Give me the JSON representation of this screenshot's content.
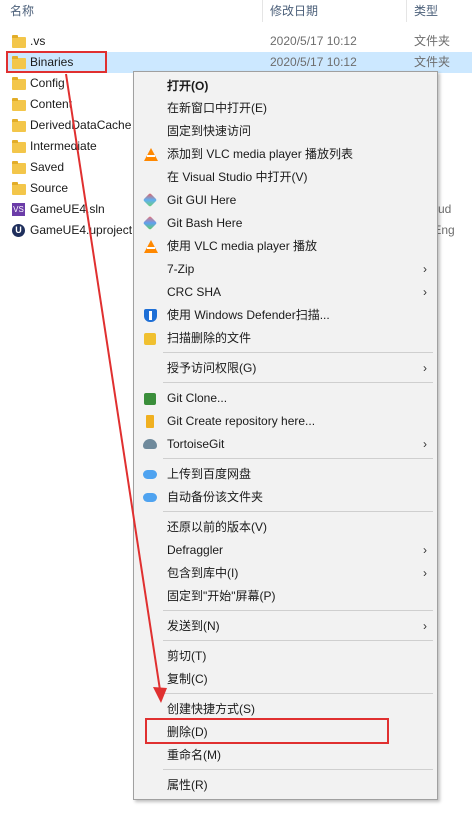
{
  "explorer": {
    "columns": {
      "name": "名称",
      "date": "修改日期",
      "type": "类型"
    },
    "files": [
      {
        "name": ".vs",
        "date": "2020/5/17 10:12",
        "type": "文件夹",
        "icon": "folder-icon"
      },
      {
        "name": "Binaries",
        "date": "2020/5/17 10:12",
        "type": "文件夹",
        "icon": "folder-icon",
        "selected": true
      },
      {
        "name": "Config",
        "date": "",
        "type": "",
        "icon": "folder-icon"
      },
      {
        "name": "Content",
        "date": "",
        "type": "",
        "icon": "folder-icon"
      },
      {
        "name": "DerivedDataCache",
        "date": "",
        "type": "",
        "icon": "folder-icon"
      },
      {
        "name": "Intermediate",
        "date": "",
        "type": "",
        "icon": "folder-icon"
      },
      {
        "name": "Saved",
        "date": "",
        "type": "",
        "icon": "folder-icon"
      },
      {
        "name": "Source",
        "date": "",
        "type": "",
        "icon": "folder-icon"
      },
      {
        "name": "GameUE4.sln",
        "date": "",
        "type": "al Stud",
        "icon": "visual-studio-icon"
      },
      {
        "name": "GameUE4.uproject",
        "date": "",
        "type": "eal Eng",
        "icon": "unreal-icon"
      }
    ]
  },
  "menu": {
    "items": [
      {
        "label": "打开(O)",
        "bold": true
      },
      {
        "label": "在新窗口中打开(E)"
      },
      {
        "label": "固定到快速访问"
      },
      {
        "label": "添加到 VLC media player 播放列表",
        "icon": "vlc-icon"
      },
      {
        "label": "在 Visual Studio 中打开(V)"
      },
      {
        "label": "Git GUI Here",
        "icon": "git-gui-icon"
      },
      {
        "label": "Git Bash Here",
        "icon": "git-bash-icon"
      },
      {
        "label": "使用 VLC media player 播放",
        "icon": "vlc-icon"
      },
      {
        "label": "7-Zip",
        "submenu": true
      },
      {
        "label": "CRC SHA",
        "submenu": true
      },
      {
        "label": "使用 Windows Defender扫描...",
        "icon": "windows-defender-icon"
      },
      {
        "label": "扫描删除的文件",
        "icon": "scan-icon"
      },
      {
        "label": "授予访问权限(G)",
        "submenu": true
      },
      {
        "label": "Git Clone...",
        "icon": "git-clone-icon"
      },
      {
        "label": "Git Create repository here...",
        "icon": "git-create-icon"
      },
      {
        "label": "TortoiseGit",
        "icon": "tortoisegit-icon",
        "submenu": true
      },
      {
        "label": "上传到百度网盘",
        "icon": "baidu-cloud-icon"
      },
      {
        "label": "自动备份该文件夹",
        "icon": "baidu-cloud-icon"
      },
      {
        "label": "还原以前的版本(V)"
      },
      {
        "label": "Defraggler",
        "submenu": true
      },
      {
        "label": "包含到库中(I)",
        "submenu": true
      },
      {
        "label": "固定到\"开始\"屏幕(P)"
      },
      {
        "label": "发送到(N)",
        "submenu": true
      },
      {
        "label": "剪切(T)"
      },
      {
        "label": "复制(C)"
      },
      {
        "label": "创建快捷方式(S)"
      },
      {
        "label": "删除(D)"
      },
      {
        "label": "重命名(M)"
      },
      {
        "label": "属性(R)"
      }
    ],
    "submenu_arrow": "›"
  },
  "colors": {
    "selection": "#cce8ff",
    "highlight": "#e03030",
    "menu_bg": "#f2f2f2"
  }
}
